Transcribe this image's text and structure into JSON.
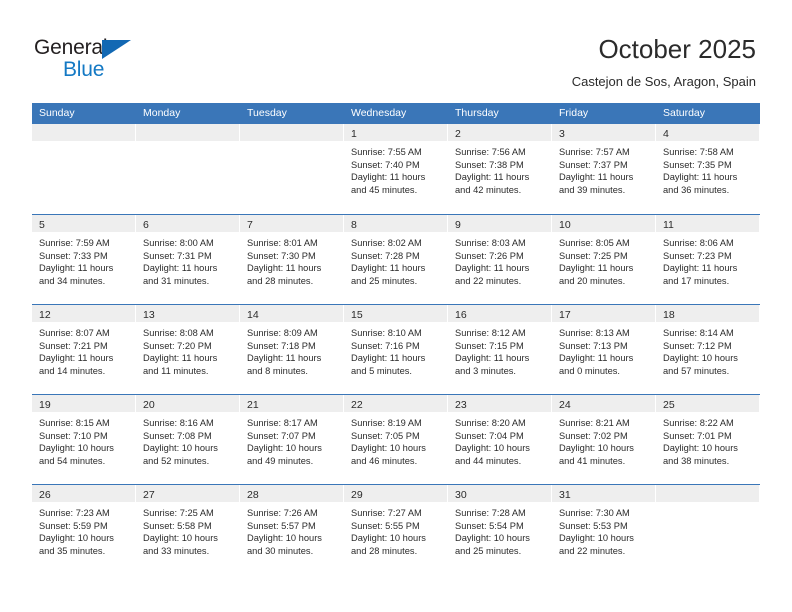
{
  "brand": {
    "name_top": "General",
    "name_bottom": "Blue",
    "accent_color": "#1479c4",
    "triangle_color": "#1268b3"
  },
  "header": {
    "title": "October 2025",
    "subtitle": "Castejon de Sos, Aragon, Spain"
  },
  "calendar": {
    "header_color": "#3a76b8",
    "weekdays": [
      "Sunday",
      "Monday",
      "Tuesday",
      "Wednesday",
      "Thursday",
      "Friday",
      "Saturday"
    ],
    "weeks": [
      [
        {
          "empty": true
        },
        {
          "empty": true
        },
        {
          "empty": true
        },
        {
          "day": "1",
          "sunrise": "Sunrise: 7:55 AM",
          "sunset": "Sunset: 7:40 PM",
          "daylight_line1": "Daylight: 11 hours",
          "daylight_line2": "and 45 minutes."
        },
        {
          "day": "2",
          "sunrise": "Sunrise: 7:56 AM",
          "sunset": "Sunset: 7:38 PM",
          "daylight_line1": "Daylight: 11 hours",
          "daylight_line2": "and 42 minutes."
        },
        {
          "day": "3",
          "sunrise": "Sunrise: 7:57 AM",
          "sunset": "Sunset: 7:37 PM",
          "daylight_line1": "Daylight: 11 hours",
          "daylight_line2": "and 39 minutes."
        },
        {
          "day": "4",
          "sunrise": "Sunrise: 7:58 AM",
          "sunset": "Sunset: 7:35 PM",
          "daylight_line1": "Daylight: 11 hours",
          "daylight_line2": "and 36 minutes."
        }
      ],
      [
        {
          "day": "5",
          "sunrise": "Sunrise: 7:59 AM",
          "sunset": "Sunset: 7:33 PM",
          "daylight_line1": "Daylight: 11 hours",
          "daylight_line2": "and 34 minutes."
        },
        {
          "day": "6",
          "sunrise": "Sunrise: 8:00 AM",
          "sunset": "Sunset: 7:31 PM",
          "daylight_line1": "Daylight: 11 hours",
          "daylight_line2": "and 31 minutes."
        },
        {
          "day": "7",
          "sunrise": "Sunrise: 8:01 AM",
          "sunset": "Sunset: 7:30 PM",
          "daylight_line1": "Daylight: 11 hours",
          "daylight_line2": "and 28 minutes."
        },
        {
          "day": "8",
          "sunrise": "Sunrise: 8:02 AM",
          "sunset": "Sunset: 7:28 PM",
          "daylight_line1": "Daylight: 11 hours",
          "daylight_line2": "and 25 minutes."
        },
        {
          "day": "9",
          "sunrise": "Sunrise: 8:03 AM",
          "sunset": "Sunset: 7:26 PM",
          "daylight_line1": "Daylight: 11 hours",
          "daylight_line2": "and 22 minutes."
        },
        {
          "day": "10",
          "sunrise": "Sunrise: 8:05 AM",
          "sunset": "Sunset: 7:25 PM",
          "daylight_line1": "Daylight: 11 hours",
          "daylight_line2": "and 20 minutes."
        },
        {
          "day": "11",
          "sunrise": "Sunrise: 8:06 AM",
          "sunset": "Sunset: 7:23 PM",
          "daylight_line1": "Daylight: 11 hours",
          "daylight_line2": "and 17 minutes."
        }
      ],
      [
        {
          "day": "12",
          "sunrise": "Sunrise: 8:07 AM",
          "sunset": "Sunset: 7:21 PM",
          "daylight_line1": "Daylight: 11 hours",
          "daylight_line2": "and 14 minutes."
        },
        {
          "day": "13",
          "sunrise": "Sunrise: 8:08 AM",
          "sunset": "Sunset: 7:20 PM",
          "daylight_line1": "Daylight: 11 hours",
          "daylight_line2": "and 11 minutes."
        },
        {
          "day": "14",
          "sunrise": "Sunrise: 8:09 AM",
          "sunset": "Sunset: 7:18 PM",
          "daylight_line1": "Daylight: 11 hours",
          "daylight_line2": "and 8 minutes."
        },
        {
          "day": "15",
          "sunrise": "Sunrise: 8:10 AM",
          "sunset": "Sunset: 7:16 PM",
          "daylight_line1": "Daylight: 11 hours",
          "daylight_line2": "and 5 minutes."
        },
        {
          "day": "16",
          "sunrise": "Sunrise: 8:12 AM",
          "sunset": "Sunset: 7:15 PM",
          "daylight_line1": "Daylight: 11 hours",
          "daylight_line2": "and 3 minutes."
        },
        {
          "day": "17",
          "sunrise": "Sunrise: 8:13 AM",
          "sunset": "Sunset: 7:13 PM",
          "daylight_line1": "Daylight: 11 hours",
          "daylight_line2": "and 0 minutes."
        },
        {
          "day": "18",
          "sunrise": "Sunrise: 8:14 AM",
          "sunset": "Sunset: 7:12 PM",
          "daylight_line1": "Daylight: 10 hours",
          "daylight_line2": "and 57 minutes."
        }
      ],
      [
        {
          "day": "19",
          "sunrise": "Sunrise: 8:15 AM",
          "sunset": "Sunset: 7:10 PM",
          "daylight_line1": "Daylight: 10 hours",
          "daylight_line2": "and 54 minutes."
        },
        {
          "day": "20",
          "sunrise": "Sunrise: 8:16 AM",
          "sunset": "Sunset: 7:08 PM",
          "daylight_line1": "Daylight: 10 hours",
          "daylight_line2": "and 52 minutes."
        },
        {
          "day": "21",
          "sunrise": "Sunrise: 8:17 AM",
          "sunset": "Sunset: 7:07 PM",
          "daylight_line1": "Daylight: 10 hours",
          "daylight_line2": "and 49 minutes."
        },
        {
          "day": "22",
          "sunrise": "Sunrise: 8:19 AM",
          "sunset": "Sunset: 7:05 PM",
          "daylight_line1": "Daylight: 10 hours",
          "daylight_line2": "and 46 minutes."
        },
        {
          "day": "23",
          "sunrise": "Sunrise: 8:20 AM",
          "sunset": "Sunset: 7:04 PM",
          "daylight_line1": "Daylight: 10 hours",
          "daylight_line2": "and 44 minutes."
        },
        {
          "day": "24",
          "sunrise": "Sunrise: 8:21 AM",
          "sunset": "Sunset: 7:02 PM",
          "daylight_line1": "Daylight: 10 hours",
          "daylight_line2": "and 41 minutes."
        },
        {
          "day": "25",
          "sunrise": "Sunrise: 8:22 AM",
          "sunset": "Sunset: 7:01 PM",
          "daylight_line1": "Daylight: 10 hours",
          "daylight_line2": "and 38 minutes."
        }
      ],
      [
        {
          "day": "26",
          "sunrise": "Sunrise: 7:23 AM",
          "sunset": "Sunset: 5:59 PM",
          "daylight_line1": "Daylight: 10 hours",
          "daylight_line2": "and 35 minutes."
        },
        {
          "day": "27",
          "sunrise": "Sunrise: 7:25 AM",
          "sunset": "Sunset: 5:58 PM",
          "daylight_line1": "Daylight: 10 hours",
          "daylight_line2": "and 33 minutes."
        },
        {
          "day": "28",
          "sunrise": "Sunrise: 7:26 AM",
          "sunset": "Sunset: 5:57 PM",
          "daylight_line1": "Daylight: 10 hours",
          "daylight_line2": "and 30 minutes."
        },
        {
          "day": "29",
          "sunrise": "Sunrise: 7:27 AM",
          "sunset": "Sunset: 5:55 PM",
          "daylight_line1": "Daylight: 10 hours",
          "daylight_line2": "and 28 minutes."
        },
        {
          "day": "30",
          "sunrise": "Sunrise: 7:28 AM",
          "sunset": "Sunset: 5:54 PM",
          "daylight_line1": "Daylight: 10 hours",
          "daylight_line2": "and 25 minutes."
        },
        {
          "day": "31",
          "sunrise": "Sunrise: 7:30 AM",
          "sunset": "Sunset: 5:53 PM",
          "daylight_line1": "Daylight: 10 hours",
          "daylight_line2": "and 22 minutes."
        },
        {
          "empty": true
        }
      ]
    ]
  }
}
